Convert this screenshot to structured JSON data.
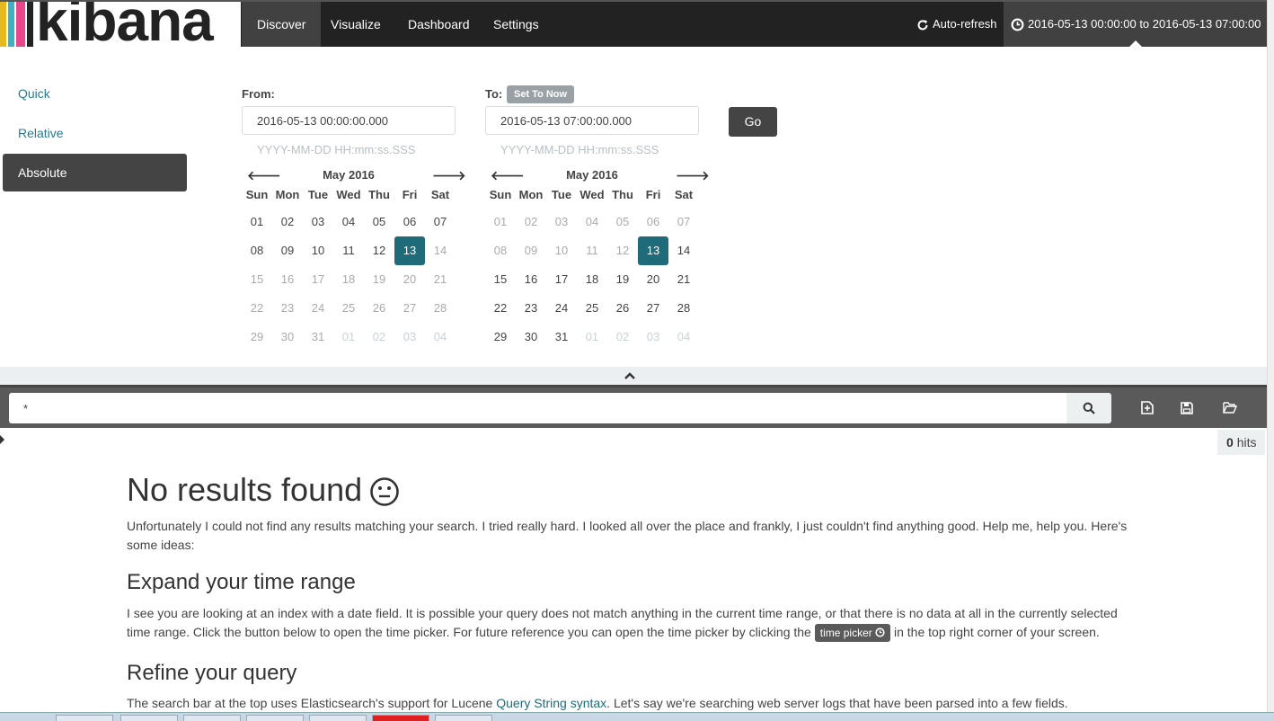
{
  "brand": {
    "name": "kibana",
    "stripe_colors": [
      "#e8b821",
      "#3fb1c1",
      "#e8478b",
      "#222222"
    ]
  },
  "nav": {
    "items": [
      {
        "label": "Discover",
        "active": true
      },
      {
        "label": "Visualize",
        "active": false
      },
      {
        "label": "Dashboard",
        "active": false
      },
      {
        "label": "Settings",
        "active": false
      }
    ],
    "auto_refresh": "Auto-refresh",
    "time_range": "2016-05-13 00:00:00 to 2016-05-13 07:00:00"
  },
  "picker": {
    "modes": [
      {
        "label": "Quick",
        "active": false
      },
      {
        "label": "Relative",
        "active": false
      },
      {
        "label": "Absolute",
        "active": true
      }
    ],
    "from_label": "From:",
    "to_label": "To:",
    "set_to_now": "Set To Now",
    "from_value": "2016-05-13 00:00:00.000",
    "to_value": "2016-05-13 07:00:00.000",
    "format_hint": "YYYY-MM-DD HH:mm:ss.SSS",
    "go": "Go",
    "calendar_title": "May 2016",
    "weekdays": [
      "Sun",
      "Mon",
      "Tue",
      "Wed",
      "Thu",
      "Fri",
      "Sat"
    ],
    "days": [
      "01",
      "02",
      "03",
      "04",
      "05",
      "06",
      "07",
      "08",
      "09",
      "10",
      "11",
      "12",
      "13",
      "14",
      "15",
      "16",
      "17",
      "18",
      "19",
      "20",
      "21",
      "22",
      "23",
      "24",
      "25",
      "26",
      "27",
      "28",
      "29",
      "30",
      "31",
      "01",
      "02",
      "03",
      "04"
    ],
    "selected_day": "13",
    "accent": "#1f6b7a"
  },
  "search": {
    "query": "*"
  },
  "hits": {
    "count": "0",
    "label": "hits"
  },
  "results": {
    "title": "No results found",
    "intro": "Unfortunately I could not find any results matching your search. I tried really hard. I looked all over the place and frankly, I just couldn't find anything good. Help me, help you. Here's some ideas:",
    "expand_title": "Expand your time range",
    "expand_text_1": "I see you are looking at an index with a date field. It is possible your query does not match anything in the current time range, or that there is no data at all in the currently selected time range. Click the button below to open the time picker. For future reference you can open the time picker by clicking the",
    "time_picker_chip": "time picker",
    "expand_text_2": "in the top right corner of your screen.",
    "refine_title": "Refine your query",
    "refine_text_1": "The search bar at the top uses Elasticsearch's support for Lucene",
    "refine_link": "Query String syntax",
    "refine_text_2": ". Let's say we're searching web server logs that have been parsed into a few fields."
  }
}
